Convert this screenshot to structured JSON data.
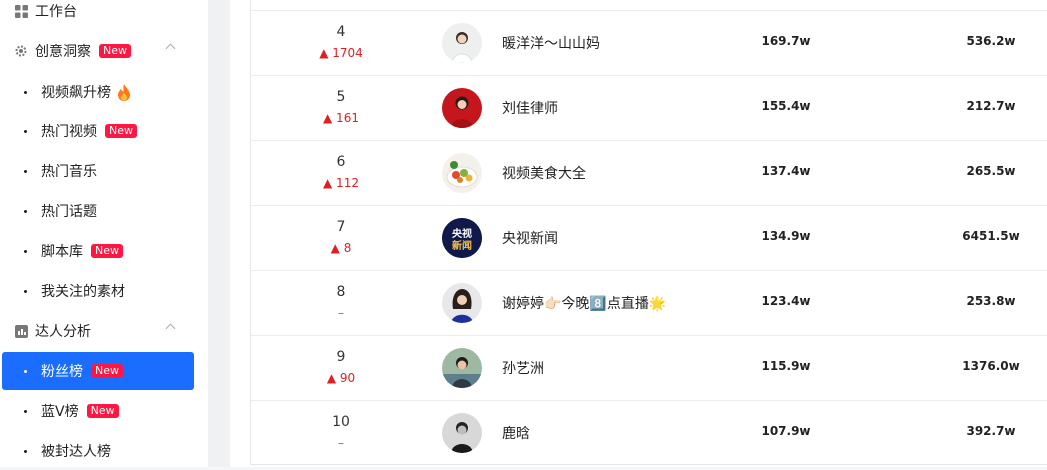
{
  "sidebar": {
    "workbench": "工作台",
    "creative_insight": {
      "label": "创意洞察",
      "badge": "New"
    },
    "creative_items": [
      {
        "label": "视频飙升榜",
        "icon": "fire-icon"
      },
      {
        "label": "热门视频",
        "badge": "New"
      },
      {
        "label": "热门音乐"
      },
      {
        "label": "热门话题"
      },
      {
        "label": "脚本库",
        "badge": "New"
      },
      {
        "label": "我关注的素材"
      }
    ],
    "influencer_analysis": {
      "label": "达人分析"
    },
    "influencer_items": [
      {
        "label": "粉丝榜",
        "badge": "New",
        "active": true
      },
      {
        "label": "蓝V榜",
        "badge": "New"
      },
      {
        "label": "被封达人榜"
      }
    ]
  },
  "ranking": {
    "rows": [
      {
        "rank": "4",
        "delta": "▲ 1704",
        "name": "暖洋洋～山山妈",
        "col1": "169.7w",
        "col2": "536.2w",
        "avatar": "avatar-woman-white"
      },
      {
        "rank": "5",
        "delta": "▲ 161",
        "name": "刘佳律师",
        "col1": "155.4w",
        "col2": "212.7w",
        "avatar": "avatar-woman-red"
      },
      {
        "rank": "6",
        "delta": "▲ 112",
        "name": "视频美食大全",
        "col1": "137.4w",
        "col2": "265.5w",
        "avatar": "avatar-food"
      },
      {
        "rank": "7",
        "delta": "▲ 8",
        "name": "央视新闻",
        "col1": "134.9w",
        "col2": "6451.5w",
        "avatar": "avatar-cctv-news",
        "avatar_text": "央视新闻"
      },
      {
        "rank": "8",
        "delta": "–",
        "name": "谢婷婷👉🏻今晚8️⃣点直播🌟",
        "col1": "123.4w",
        "col2": "253.8w",
        "avatar": "avatar-woman-blue"
      },
      {
        "rank": "9",
        "delta": "▲ 90",
        "name": "孙艺洲",
        "col1": "115.9w",
        "col2": "1376.0w",
        "avatar": "avatar-man-outdoor"
      },
      {
        "rank": "10",
        "delta": "–",
        "name": "鹿晗",
        "col1": "107.9w",
        "col2": "392.7w",
        "avatar": "avatar-man-gray"
      }
    ]
  },
  "colors": {
    "accent": "#1a6dff",
    "badge": "#ff1744",
    "up": "#e02020"
  }
}
